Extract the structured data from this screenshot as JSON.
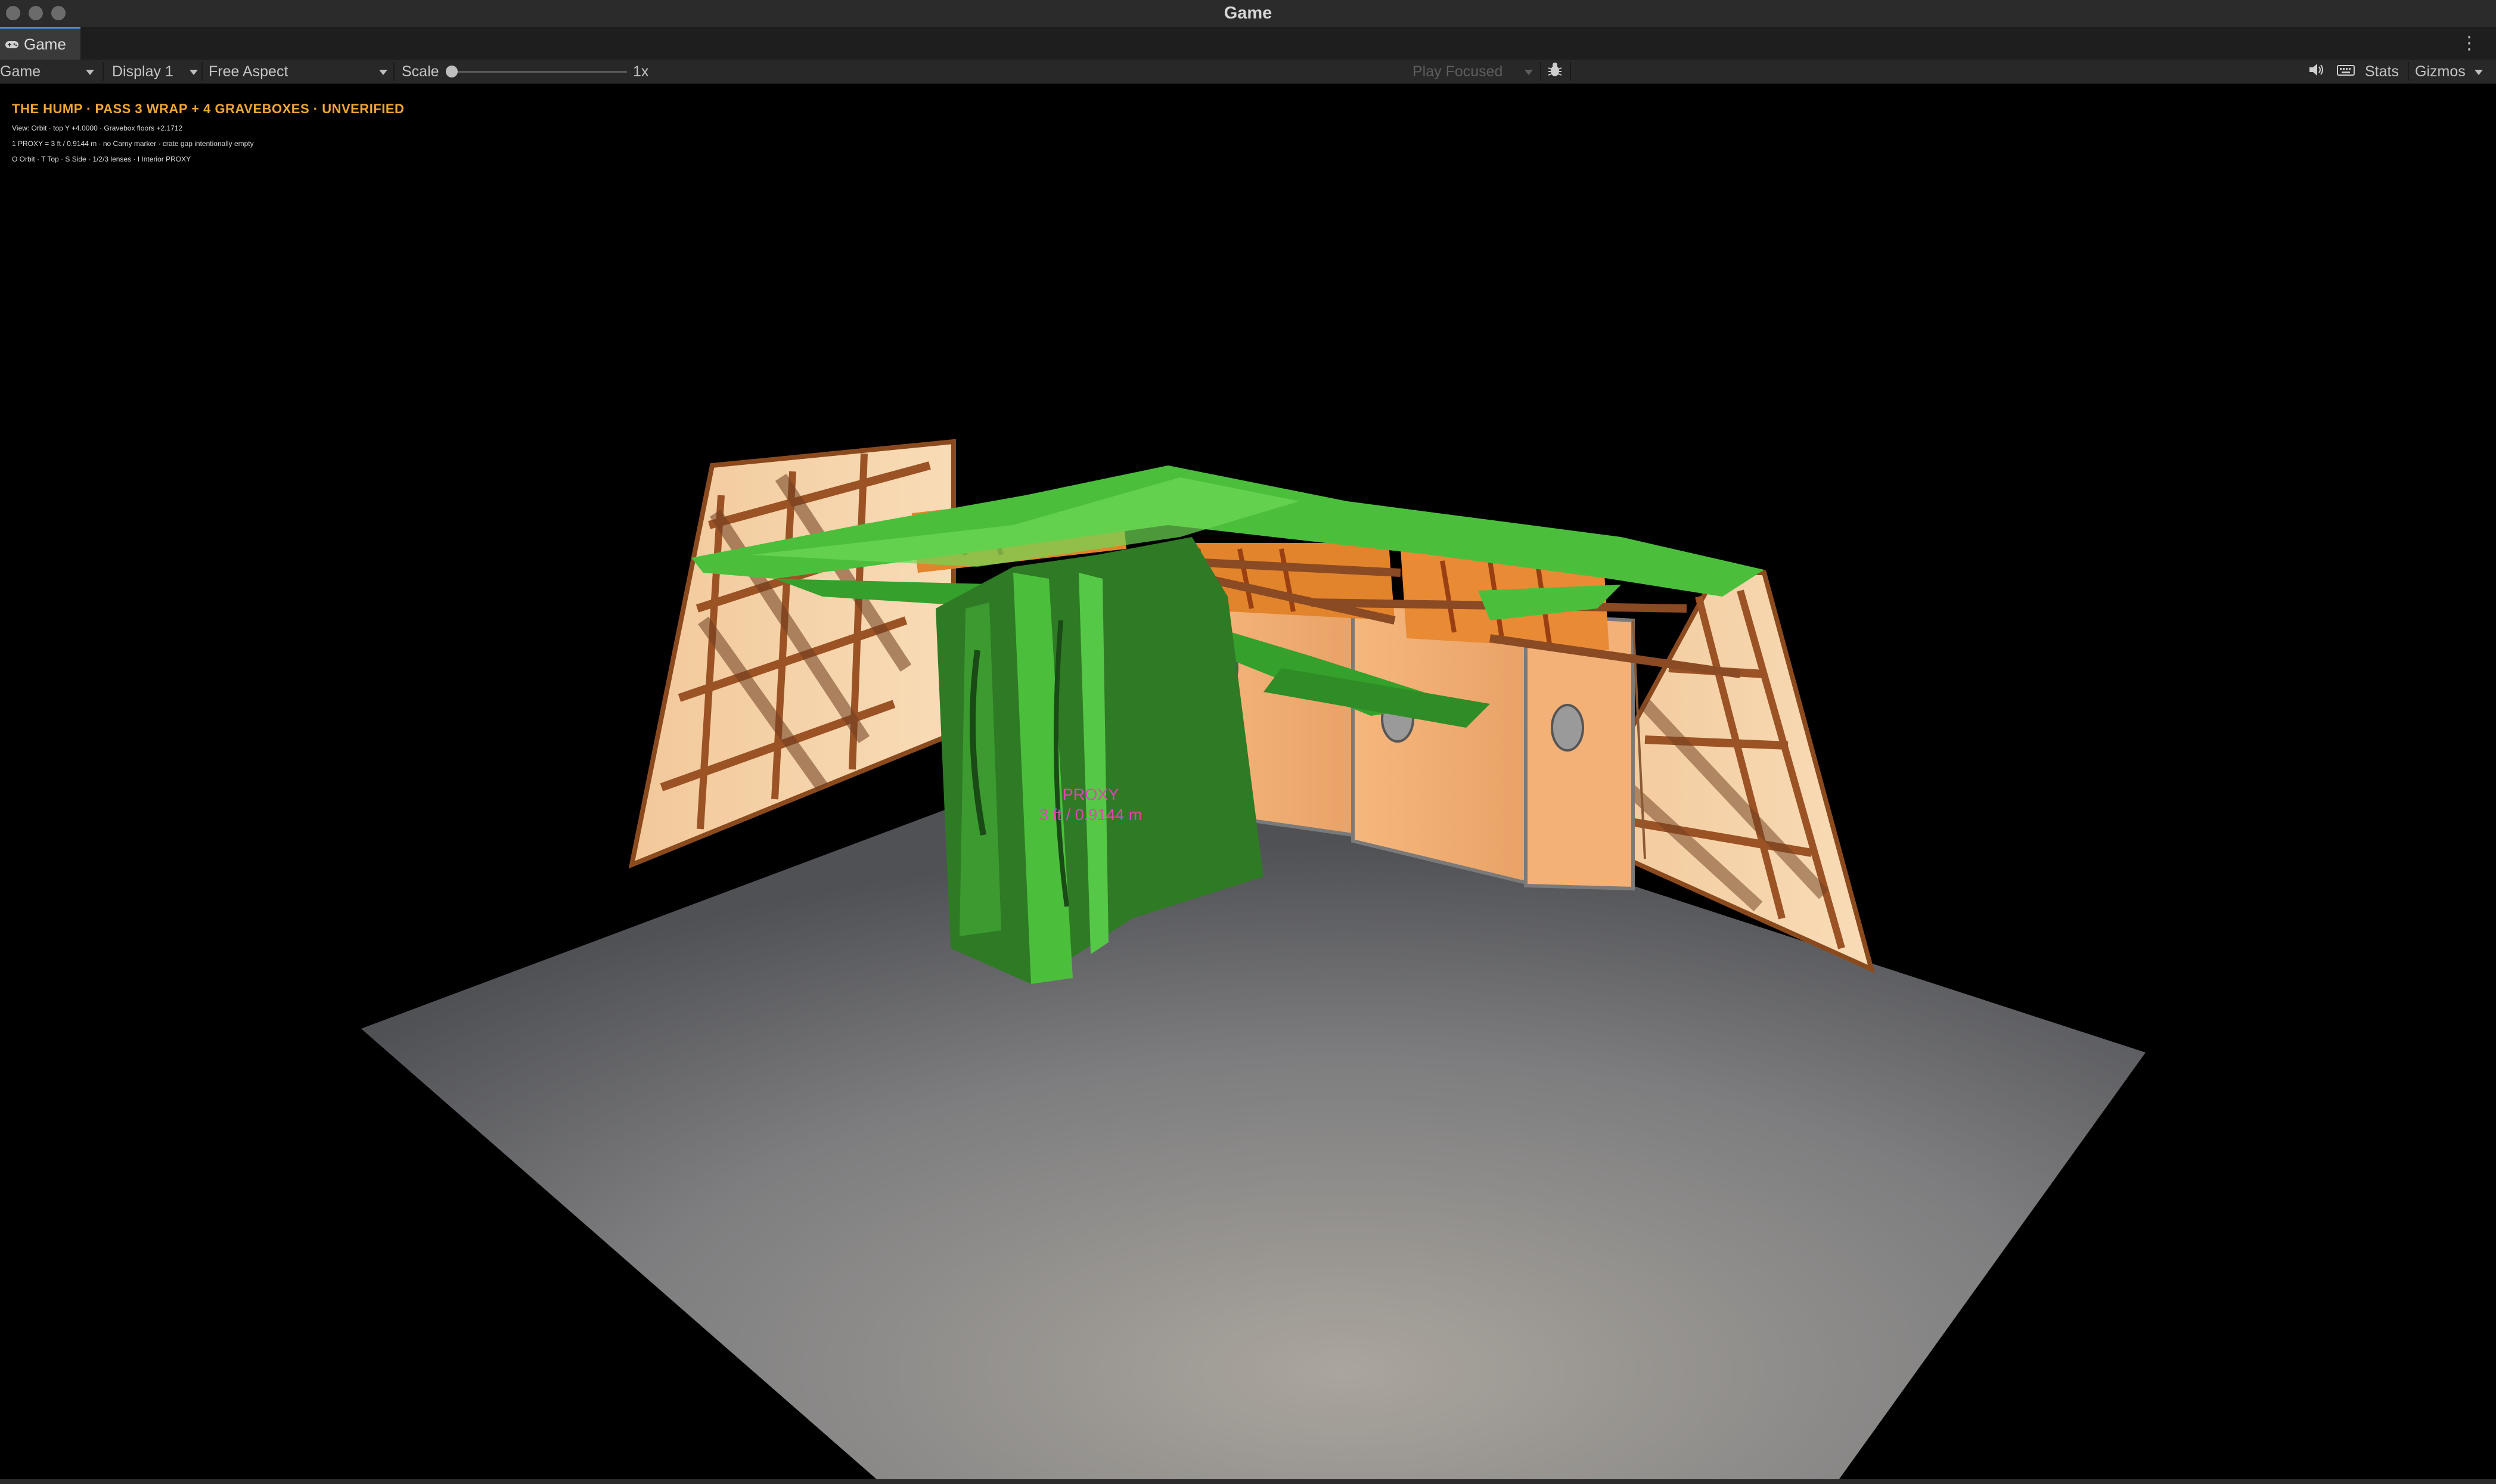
{
  "window": {
    "title": "Game"
  },
  "tab": {
    "label": "Game",
    "icon": "gamepad-icon"
  },
  "toolbar": {
    "mode": "Game",
    "display": "Display 1",
    "aspect": "Free Aspect",
    "scale_label": "Scale",
    "scale_value": "1x",
    "play_focus": "Play Focused",
    "stats": "Stats",
    "gizmos": "Gizmos"
  },
  "overlay": {
    "title": "THE HUMP · PASS 3 WRAP + 4 GRAVEBOXES · UNVERIFIED",
    "line1": "View: Orbit · top Y +4.0000 · Gravebox floors +2.1712",
    "line2": "1 PROXY = 3 ft / 0.9144 m · no Carny marker · crate gap intentionally empty",
    "line3": "O Orbit · T Top · S Side · 1/2/3 lenses · I Interior PROXY"
  },
  "proxy": {
    "line1": "PROXY",
    "line2": "3 ft / 0.9144 m"
  },
  "colors": {
    "accent_tab": "#4e8fd6",
    "overlay_title": "#f2a634",
    "proxy_label": "#e046b4",
    "grass": "#4bbf3c",
    "wall": "#f5cfa3",
    "floor": "#8a8a8a"
  }
}
